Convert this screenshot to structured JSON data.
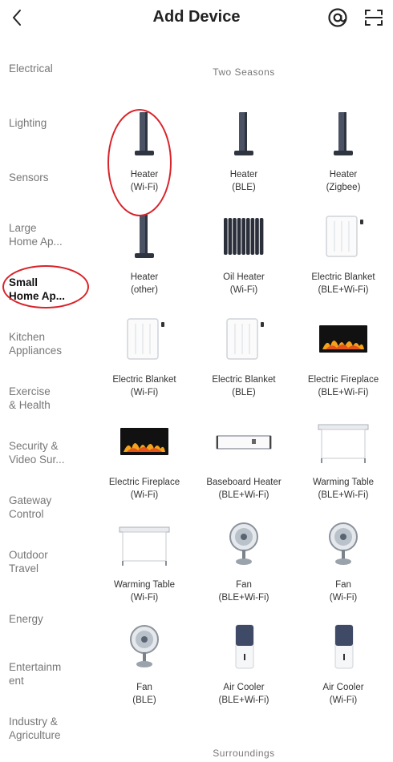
{
  "header": {
    "title": "Add Device"
  },
  "sidebar": {
    "items": [
      {
        "label": "Electrical"
      },
      {
        "label": "Lighting"
      },
      {
        "label": "Sensors"
      },
      {
        "label": "Large\nHome Ap..."
      },
      {
        "label": "Small\nHome Ap...",
        "active": true
      },
      {
        "label": "Kitchen\nAppliances"
      },
      {
        "label": "Exercise\n& Health"
      },
      {
        "label": "Security &\nVideo Sur..."
      },
      {
        "label": "Gateway\nControl"
      },
      {
        "label": "Outdoor\nTravel"
      },
      {
        "label": "Energy"
      },
      {
        "label": "Entertainm\nent"
      },
      {
        "label": "Industry &\nAgriculture"
      }
    ]
  },
  "sections": {
    "two_seasons": "Two Seasons",
    "surroundings": "Surroundings"
  },
  "devices": [
    {
      "name": "Heater",
      "sub": "(Wi-Fi)",
      "icon": "heater-icon"
    },
    {
      "name": "Heater",
      "sub": "(BLE)",
      "icon": "heater-icon"
    },
    {
      "name": "Heater",
      "sub": "(Zigbee)",
      "icon": "heater-icon"
    },
    {
      "name": "Heater",
      "sub": "(other)",
      "icon": "heater-icon"
    },
    {
      "name": "Oil Heater",
      "sub": "(Wi-Fi)",
      "icon": "oil-heater-icon"
    },
    {
      "name": "Electric Blanket",
      "sub": "(BLE+Wi-Fi)",
      "icon": "electric-blanket-icon"
    },
    {
      "name": "Electric Blanket",
      "sub": "(Wi-Fi)",
      "icon": "electric-blanket-icon"
    },
    {
      "name": "Electric Blanket",
      "sub": "(BLE)",
      "icon": "electric-blanket-icon"
    },
    {
      "name": "Electric Fireplace",
      "sub": "(BLE+Wi-Fi)",
      "icon": "electric-fireplace-icon"
    },
    {
      "name": "Electric Fireplace",
      "sub": "(Wi-Fi)",
      "icon": "electric-fireplace-icon"
    },
    {
      "name": "Baseboard Heater",
      "sub": "(BLE+Wi-Fi)",
      "icon": "baseboard-heater-icon"
    },
    {
      "name": "Warming Table",
      "sub": "(BLE+Wi-Fi)",
      "icon": "warming-table-icon"
    },
    {
      "name": "Warming Table",
      "sub": "(Wi-Fi)",
      "icon": "warming-table-icon"
    },
    {
      "name": "Fan",
      "sub": "(BLE+Wi-Fi)",
      "icon": "fan-icon"
    },
    {
      "name": "Fan",
      "sub": "(Wi-Fi)",
      "icon": "fan-icon"
    },
    {
      "name": "Fan",
      "sub": "(BLE)",
      "icon": "fan-icon"
    },
    {
      "name": "Air Cooler",
      "sub": "(BLE+Wi-Fi)",
      "icon": "air-cooler-icon"
    },
    {
      "name": "Air Cooler",
      "sub": "(Wi-Fi)",
      "icon": "air-cooler-icon"
    }
  ],
  "colors": {
    "highlight": "#d8232a",
    "text": "#222222",
    "muted": "#777777"
  }
}
